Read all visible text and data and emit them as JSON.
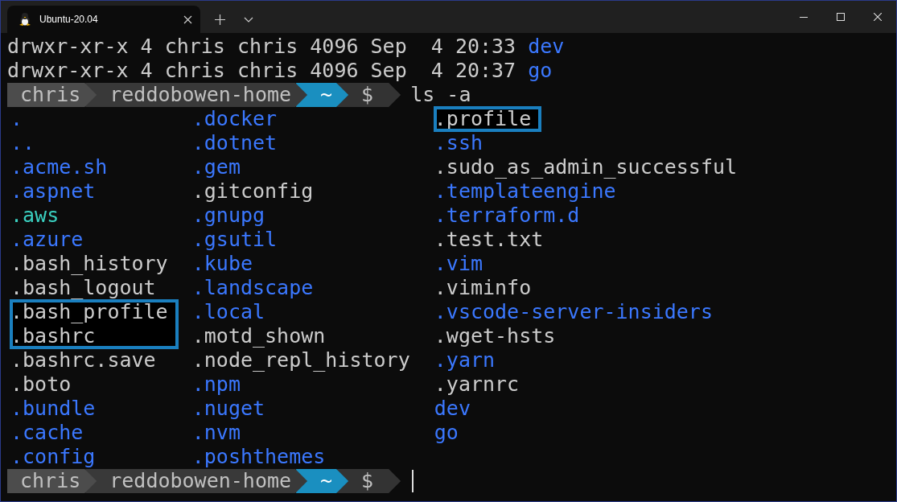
{
  "tab": {
    "title": "Ubuntu-20.04",
    "selected": true
  },
  "long_listing": [
    {
      "meta": "drwxr-xr-x 4 chris chris 4096 Sep  4 20:33",
      "name": "dev",
      "kind": "dir"
    },
    {
      "meta": "drwxr-xr-x 4 chris chris 4096 Sep  4 20:37",
      "name": "go",
      "kind": "dir"
    }
  ],
  "prompts": [
    {
      "segments": [
        {
          "text": "chris",
          "color": "#4c4c4c"
        },
        {
          "text": "reddobowen-home",
          "color": "#393939"
        },
        {
          "text": "~",
          "color": "#1a8fc0"
        },
        {
          "text": "$",
          "color": "#333333"
        }
      ],
      "command": "ls -a"
    }
  ],
  "listing_columns": [
    [
      {
        "name": ".",
        "kind": "dir",
        "highlighted": false
      },
      {
        "name": "..",
        "kind": "dir",
        "highlighted": false
      },
      {
        "name": ".acme.sh",
        "kind": "dir",
        "highlighted": false
      },
      {
        "name": ".aspnet",
        "kind": "dir",
        "highlighted": false
      },
      {
        "name": ".aws",
        "kind": "special",
        "highlighted": false
      },
      {
        "name": ".azure",
        "kind": "dir",
        "highlighted": false
      },
      {
        "name": ".bash_history",
        "kind": "file",
        "highlighted": false
      },
      {
        "name": ".bash_logout",
        "kind": "file",
        "highlighted": false
      },
      {
        "name": ".bash_profile",
        "kind": "file",
        "highlighted": true
      },
      {
        "name": ".bashrc",
        "kind": "file",
        "highlighted": true
      },
      {
        "name": ".bashrc.save",
        "kind": "file",
        "highlighted": false
      },
      {
        "name": ".boto",
        "kind": "file",
        "highlighted": false
      },
      {
        "name": ".bundle",
        "kind": "dir",
        "highlighted": false
      },
      {
        "name": ".cache",
        "kind": "dir",
        "highlighted": false
      },
      {
        "name": ".config",
        "kind": "dir",
        "highlighted": false
      }
    ],
    [
      {
        "name": ".docker",
        "kind": "dir",
        "highlighted": false
      },
      {
        "name": ".dotnet",
        "kind": "dir",
        "highlighted": false
      },
      {
        "name": ".gem",
        "kind": "dir",
        "highlighted": false
      },
      {
        "name": ".gitconfig",
        "kind": "file",
        "highlighted": false
      },
      {
        "name": ".gnupg",
        "kind": "dir",
        "highlighted": false
      },
      {
        "name": ".gsutil",
        "kind": "dir",
        "highlighted": false
      },
      {
        "name": ".kube",
        "kind": "dir",
        "highlighted": false
      },
      {
        "name": ".landscape",
        "kind": "dir",
        "highlighted": false
      },
      {
        "name": ".local",
        "kind": "dir",
        "highlighted": false
      },
      {
        "name": ".motd_shown",
        "kind": "file",
        "highlighted": false
      },
      {
        "name": ".node_repl_history",
        "kind": "file",
        "highlighted": false
      },
      {
        "name": ".npm",
        "kind": "dir",
        "highlighted": false
      },
      {
        "name": ".nuget",
        "kind": "dir",
        "highlighted": false
      },
      {
        "name": ".nvm",
        "kind": "dir",
        "highlighted": false
      },
      {
        "name": ".poshthemes",
        "kind": "dir",
        "highlighted": false
      }
    ],
    [
      {
        "name": ".profile",
        "kind": "file",
        "highlighted": true
      },
      {
        "name": ".ssh",
        "kind": "dir",
        "highlighted": false
      },
      {
        "name": ".sudo_as_admin_successful",
        "kind": "file",
        "highlighted": false
      },
      {
        "name": ".templateengine",
        "kind": "dir",
        "highlighted": false
      },
      {
        "name": ".terraform.d",
        "kind": "dir",
        "highlighted": false
      },
      {
        "name": ".test.txt",
        "kind": "file",
        "highlighted": false
      },
      {
        "name": ".vim",
        "kind": "dir",
        "highlighted": false
      },
      {
        "name": ".viminfo",
        "kind": "file",
        "highlighted": false
      },
      {
        "name": ".vscode-server-insiders",
        "kind": "dir",
        "highlighted": false
      },
      {
        "name": ".wget-hsts",
        "kind": "file",
        "highlighted": false
      },
      {
        "name": ".yarn",
        "kind": "dir",
        "highlighted": false
      },
      {
        "name": ".yarnrc",
        "kind": "file",
        "highlighted": false
      },
      {
        "name": "dev",
        "kind": "dir",
        "highlighted": false
      },
      {
        "name": "go",
        "kind": "dir",
        "highlighted": false
      }
    ]
  ],
  "final_prompt": {
    "segments": [
      {
        "text": "chris",
        "color": "#4c4c4c"
      },
      {
        "text": "reddobowen-home",
        "color": "#393939"
      },
      {
        "text": "~",
        "color": "#1a8fc0"
      },
      {
        "text": "$",
        "color": "#333333"
      }
    ]
  }
}
